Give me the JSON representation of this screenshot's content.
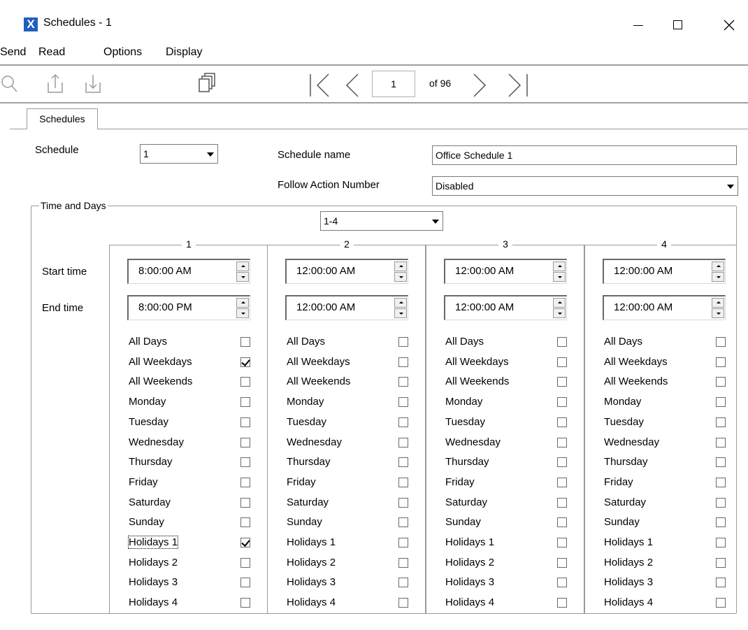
{
  "window": {
    "title": "Schedules - 1",
    "app_icon_glyph": "X"
  },
  "menu": [
    "Send",
    "Read",
    "Options",
    "Display"
  ],
  "toolbar": {
    "icons": [
      "search-icon",
      "upload-icon",
      "download-icon",
      "copy-icon",
      "first-page-icon",
      "previous-page-icon",
      "next-page-icon",
      "last-page-icon"
    ],
    "page": "1",
    "of_text": "of 96"
  },
  "tabs": [
    "Schedules"
  ],
  "form": {
    "schedule_label": "Schedule",
    "schedule_value": "1",
    "schedule_name_label": "Schedule name",
    "schedule_name_value": "Office Schedule 1",
    "follow_action_label": "Follow Action Number",
    "follow_action_value": "Disabled"
  },
  "time_days": {
    "group_title": "Time and Days",
    "range_value": "1-4",
    "start_time_label": "Start time",
    "end_time_label": "End time",
    "columns": [
      {
        "title": "1",
        "start": "8:00:00 AM",
        "end": "8:00:00 PM",
        "days": [
          {
            "label": "All Days",
            "checked": false
          },
          {
            "label": "All Weekdays",
            "checked": true
          },
          {
            "label": "All Weekends",
            "checked": false
          },
          {
            "label": "Monday",
            "checked": false
          },
          {
            "label": "Tuesday",
            "checked": false
          },
          {
            "label": "Wednesday",
            "checked": false
          },
          {
            "label": "Thursday",
            "checked": false
          },
          {
            "label": "Friday",
            "checked": false
          },
          {
            "label": "Saturday",
            "checked": false
          },
          {
            "label": "Sunday",
            "checked": false
          },
          {
            "label": "Holidays 1",
            "checked": true
          },
          {
            "label": "Holidays 2",
            "checked": false
          },
          {
            "label": "Holidays 3",
            "checked": false
          },
          {
            "label": "Holidays 4",
            "checked": false
          }
        ]
      },
      {
        "title": "2",
        "start": "12:00:00 AM",
        "end": "12:00:00 AM",
        "days": [
          {
            "label": "All Days",
            "checked": false
          },
          {
            "label": "All Weekdays",
            "checked": false
          },
          {
            "label": "All Weekends",
            "checked": false
          },
          {
            "label": "Monday",
            "checked": false
          },
          {
            "label": "Tuesday",
            "checked": false
          },
          {
            "label": "Wednesday",
            "checked": false
          },
          {
            "label": "Thursday",
            "checked": false
          },
          {
            "label": "Friday",
            "checked": false
          },
          {
            "label": "Saturday",
            "checked": false
          },
          {
            "label": "Sunday",
            "checked": false
          },
          {
            "label": "Holidays 1",
            "checked": false
          },
          {
            "label": "Holidays 2",
            "checked": false
          },
          {
            "label": "Holidays 3",
            "checked": false
          },
          {
            "label": "Holidays 4",
            "checked": false
          }
        ]
      },
      {
        "title": "3",
        "start": "12:00:00 AM",
        "end": "12:00:00 AM",
        "days": [
          {
            "label": "All Days",
            "checked": false
          },
          {
            "label": "All Weekdays",
            "checked": false
          },
          {
            "label": "All Weekends",
            "checked": false
          },
          {
            "label": "Monday",
            "checked": false
          },
          {
            "label": "Tuesday",
            "checked": false
          },
          {
            "label": "Wednesday",
            "checked": false
          },
          {
            "label": "Thursday",
            "checked": false
          },
          {
            "label": "Friday",
            "checked": false
          },
          {
            "label": "Saturday",
            "checked": false
          },
          {
            "label": "Sunday",
            "checked": false
          },
          {
            "label": "Holidays 1",
            "checked": false
          },
          {
            "label": "Holidays 2",
            "checked": false
          },
          {
            "label": "Holidays 3",
            "checked": false
          },
          {
            "label": "Holidays 4",
            "checked": false
          }
        ]
      },
      {
        "title": "4",
        "start": "12:00:00 AM",
        "end": "12:00:00 AM",
        "days": [
          {
            "label": "All Days",
            "checked": false
          },
          {
            "label": "All Weekdays",
            "checked": false
          },
          {
            "label": "All Weekends",
            "checked": false
          },
          {
            "label": "Monday",
            "checked": false
          },
          {
            "label": "Tuesday",
            "checked": false
          },
          {
            "label": "Wednesday",
            "checked": false
          },
          {
            "label": "Thursday",
            "checked": false
          },
          {
            "label": "Friday",
            "checked": false
          },
          {
            "label": "Saturday",
            "checked": false
          },
          {
            "label": "Sunday",
            "checked": false
          },
          {
            "label": "Holidays 1",
            "checked": false
          },
          {
            "label": "Holidays 2",
            "checked": false
          },
          {
            "label": "Holidays 3",
            "checked": false
          },
          {
            "label": "Holidays 4",
            "checked": false
          }
        ]
      }
    ]
  },
  "colors": {
    "app_icon": "#1f5fbf",
    "border": "#9a9a9a",
    "toolbar_icon": "#9a9a9a"
  }
}
